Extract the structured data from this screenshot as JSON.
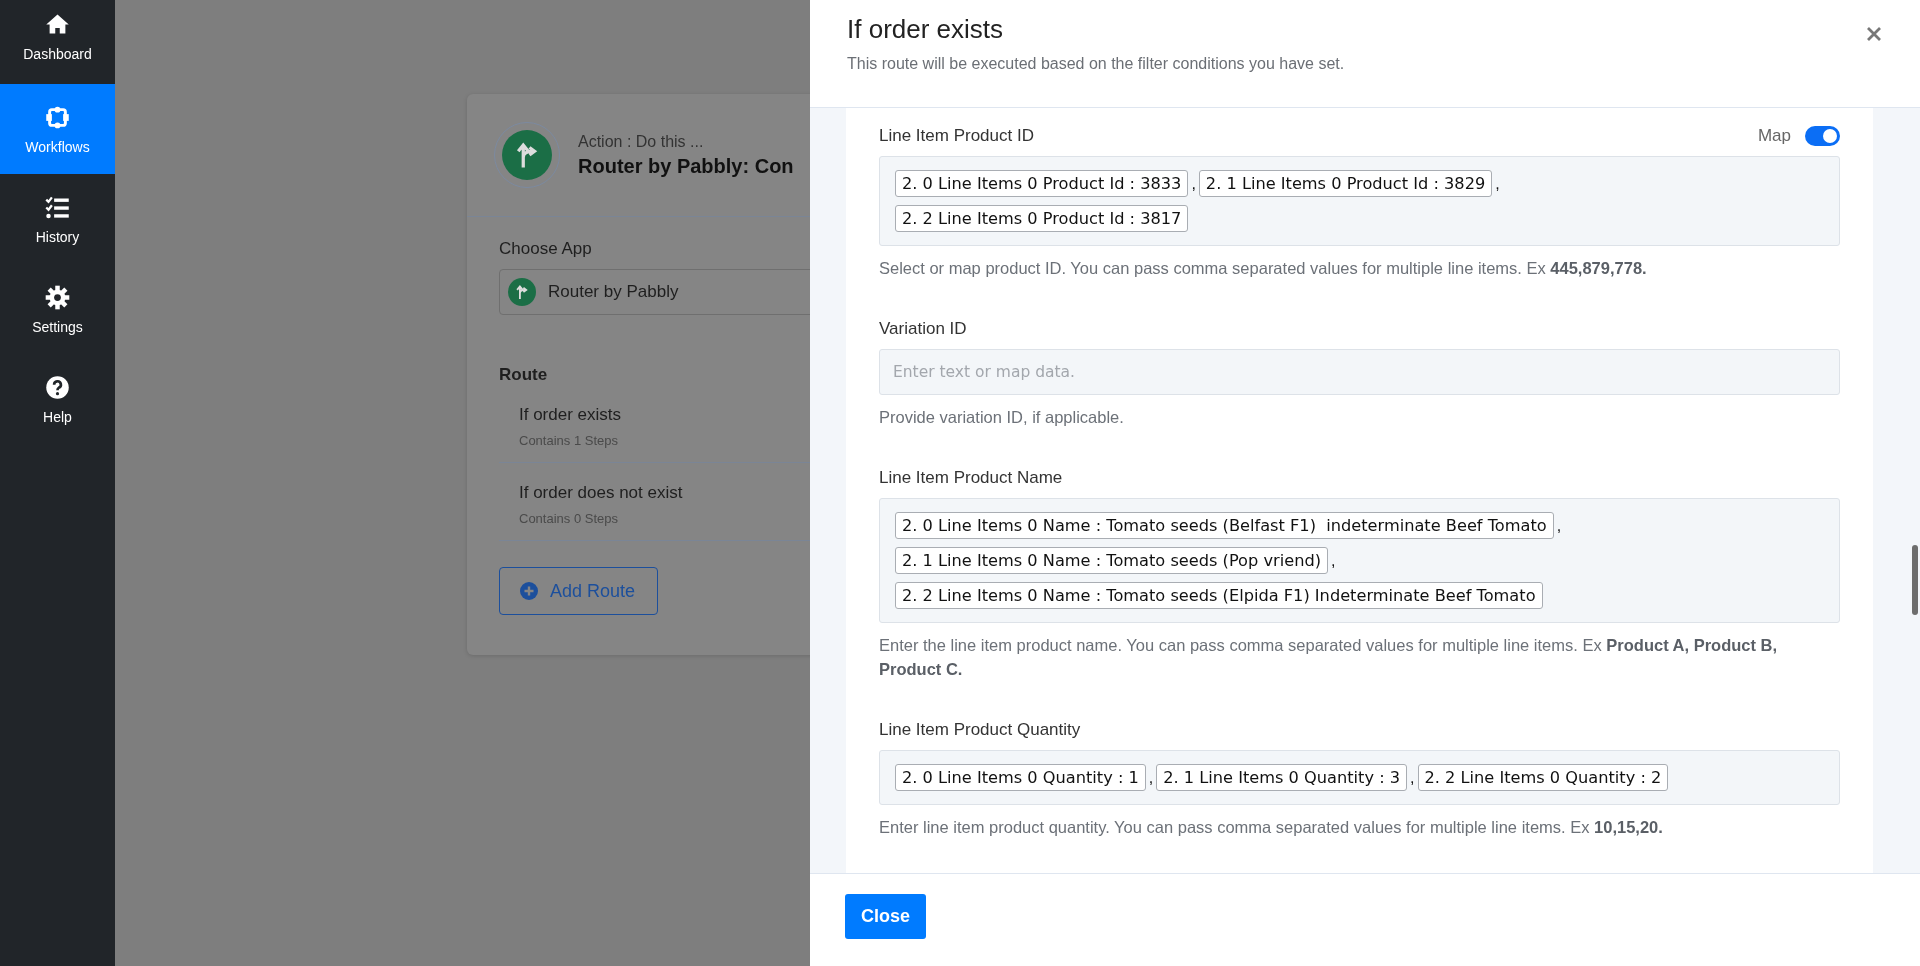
{
  "sidebar": {
    "items": [
      {
        "label": "Dashboard",
        "selected": false
      },
      {
        "label": "Workflows",
        "selected": true
      },
      {
        "label": "History",
        "selected": false
      },
      {
        "label": "Settings",
        "selected": false
      },
      {
        "label": "Help",
        "selected": false
      }
    ]
  },
  "card": {
    "action_label": "Action : Do this ...",
    "title": "Router by Pabbly: Con",
    "choose_app_label": "Choose App",
    "app_value": "Router by Pabbly",
    "route_heading": "Route",
    "routes": [
      {
        "name": "If order exists",
        "steps": "Contains 1 Steps"
      },
      {
        "name": "If order does not exist",
        "steps": "Contains 0 Steps"
      }
    ],
    "add_route_button": "Add Route"
  },
  "modal": {
    "title": "If order exists",
    "subtitle": "This route will be executed based on the filter conditions you have set.",
    "fields": [
      {
        "kind": "tags",
        "label": "Line Item Product ID",
        "map_toggle": {
          "label": "Map",
          "on": true
        },
        "tags": [
          {
            "text": "2. 0 Line Items 0 Product Id : 3833",
            "separator": ","
          },
          {
            "text": "2. 1 Line Items 0 Product Id : 3829",
            "separator": ","
          },
          {
            "text": "2. 2 Line Items 0 Product Id : 3817"
          }
        ],
        "help": "Select or map product ID. You can pass comma separated values for multiple line items. Ex **445,879,778.**"
      },
      {
        "kind": "text",
        "label": "Variation ID",
        "placeholder": "Enter text or map data.",
        "help": "Provide variation ID, if applicable."
      },
      {
        "kind": "tags",
        "label": "Line Item Product Name",
        "tags": [
          {
            "text": "2. 0 Line Items 0 Name : Tomato seeds (Belfast F1)  indeterminate Beef Tomato",
            "separator": ","
          },
          {
            "text": "2. 1 Line Items 0 Name : Tomato seeds (Pop vriend)",
            "separator": ","
          },
          {
            "text": "2. 2 Line Items 0 Name : Tomato seeds (Elpida F1) Indeterminate Beef Tomato"
          }
        ],
        "help": "Enter the line item product name. You can pass comma separated values for multiple line items. Ex **Product A, Product B, Product C.**"
      },
      {
        "kind": "tags",
        "label": "Line Item Product Quantity",
        "tags": [
          {
            "text": "2. 0 Line Items 0 Quantity : 1",
            "separator": ","
          },
          {
            "text": "2. 1 Line Items 0 Quantity : 3",
            "separator": ","
          },
          {
            "text": "2. 2 Line Items 0 Quantity : 2"
          }
        ],
        "help": "Enter line item product quantity. You can pass comma separated values for multiple line items. Ex **10,15,20.**"
      }
    ],
    "close_button": "Close"
  }
}
